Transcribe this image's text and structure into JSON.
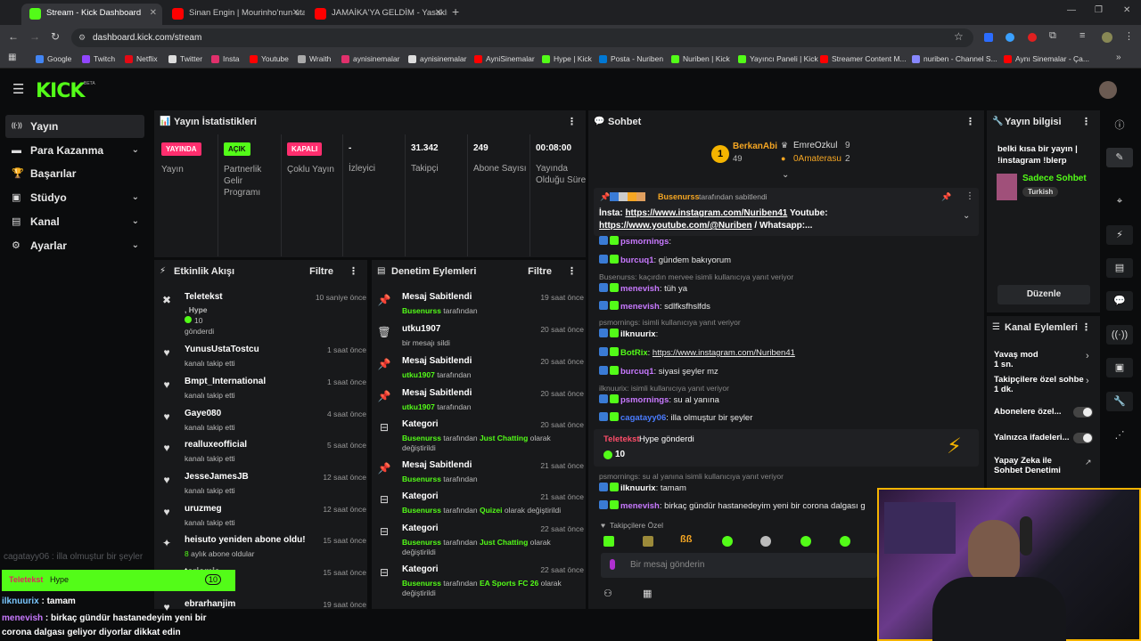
{
  "browser": {
    "tabs": [
      {
        "label": "Stream - Kick Dashboard",
        "active": true,
        "color": "#53fc18"
      },
      {
        "label": "Sinan Engin | Mourinho'nun uta",
        "active": false,
        "color": "#ff0000"
      },
      {
        "label": "JAMAİKA'YA GELDİM - Yasaklı",
        "active": false,
        "color": "#ff0000"
      }
    ],
    "url": "dashboard.kick.com/stream",
    "bookmarks": [
      {
        "label": "Google",
        "color": "#4285f4"
      },
      {
        "label": "Twitch",
        "color": "#9146ff"
      },
      {
        "label": "Netflix",
        "color": "#e50914"
      },
      {
        "label": "Twitter",
        "color": "#dddddd"
      },
      {
        "label": "Insta",
        "color": "#e1306c"
      },
      {
        "label": "Youtube",
        "color": "#ff0000"
      },
      {
        "label": "Wraith",
        "color": "#aaaaaa"
      },
      {
        "label": "aynisinemalar",
        "color": "#e1306c"
      },
      {
        "label": "aynisinemalar",
        "color": "#dddddd"
      },
      {
        "label": "AyniSinemalar",
        "color": "#ff0000"
      },
      {
        "label": "Hype | Kick",
        "color": "#53fc18"
      },
      {
        "label": "Posta - Nuriben",
        "color": "#0078d4"
      },
      {
        "label": "Nuriben | Kick",
        "color": "#53fc18"
      },
      {
        "label": "Yayıncı Paneli | Kick",
        "color": "#53fc18"
      },
      {
        "label": "Streamer Content M...",
        "color": "#ff0000"
      },
      {
        "label": "nuriben - Channel S...",
        "color": "#8888ff"
      },
      {
        "label": "Aynı Sinemalar - Ça...",
        "color": "#ff0000"
      }
    ]
  },
  "kick": {
    "logo": "KICK",
    "beta": "BETA",
    "nav": [
      {
        "label": "Yayın",
        "icon": "broadcast-icon",
        "glyph": "((·))",
        "selected": true,
        "expandable": false
      },
      {
        "label": "Para Kazanma",
        "icon": "money-icon",
        "glyph": "▬",
        "selected": false,
        "expandable": true
      },
      {
        "label": "Başarılar",
        "icon": "trophy-icon",
        "glyph": "🏆",
        "selected": false,
        "expandable": false
      },
      {
        "label": "Stüdyo",
        "icon": "studio-icon",
        "glyph": "▣",
        "selected": false,
        "expandable": true
      },
      {
        "label": "Kanal",
        "icon": "channel-icon",
        "glyph": "▤",
        "selected": false,
        "expandable": true
      },
      {
        "label": "Ayarlar",
        "icon": "gear-icon",
        "glyph": "⚙",
        "selected": false,
        "expandable": true
      }
    ]
  },
  "stats": {
    "title": "Yayın İstatistikleri",
    "items": [
      {
        "badge": "YAYINDA",
        "badge_color": "#ff2e6e",
        "label": "Yayın"
      },
      {
        "badge": "AÇIK",
        "badge_color": "#53fc18",
        "label": "Partnerlik Gelir Programı"
      },
      {
        "badge": "KAPALI",
        "badge_color": "#ff2e6e",
        "label": "Çoklu Yayın"
      },
      {
        "value": "-",
        "label": "İzleyici"
      },
      {
        "value": "31.342",
        "label": "Takipçi"
      },
      {
        "value": "249",
        "label": "Abone Sayısı"
      },
      {
        "value": "00:08:00",
        "label": "Yayında Olduğu Süre"
      }
    ]
  },
  "activity": {
    "title": "Etkinlik Akışı",
    "filter": "Filtre",
    "items": [
      {
        "name": "Teletekst",
        "line2": ", Hype",
        "line3": "10",
        "line4": "gönderdi",
        "time": "10 saniye önce",
        "icon": "kick-coin-icon"
      },
      {
        "name": "YunusUstaTostcu",
        "sub": "kanalı takip etti",
        "time": "1 saat önce",
        "icon": "heart-icon"
      },
      {
        "name": "Bmpt_International",
        "sub": "kanalı takip etti",
        "time": "1 saat önce",
        "icon": "heart-icon"
      },
      {
        "name": "Gaye080",
        "sub": "kanalı takip etti",
        "time": "4 saat önce",
        "icon": "heart-icon"
      },
      {
        "name": "realluxeofficial",
        "sub": "kanalı takip etti",
        "time": "5 saat önce",
        "icon": "heart-icon"
      },
      {
        "name": "JesseJamesJB",
        "sub": "kanalı takip etti",
        "time": "12 saat önce",
        "icon": "heart-icon"
      },
      {
        "name": "uruzmeg",
        "sub": "kanalı takip etti",
        "time": "12 saat önce",
        "icon": "heart-icon"
      },
      {
        "name": "heisuto yeniden abone oldu!",
        "sub_green": "8",
        "sub": " aylık abone oldular",
        "time": "15 saat önce",
        "icon": "sparkle-icon"
      },
      {
        "name": "toriomia",
        "sub": "",
        "time": "15 saat önce",
        "icon": "heart-icon"
      },
      {
        "name": "ebrarhanjim",
        "sub": "",
        "time": "19 saat önce",
        "icon": "heart-icon"
      }
    ]
  },
  "moderation": {
    "title": "Denetim Eylemleri",
    "filter": "Filtre",
    "items": [
      {
        "name": "Mesaj Sabitlendi",
        "green": "Busenurss",
        "rest": " tarafından",
        "time": "19 saat önce",
        "icon": "pin-icon"
      },
      {
        "name": "utku1907",
        "green": "",
        "rest": "bir mesajı sildi",
        "time": "20 saat önce",
        "icon": "trash-icon"
      },
      {
        "name": "Mesaj Sabitlendi",
        "green": "utku1907",
        "rest": " tarafından",
        "time": "20 saat önce",
        "icon": "pin-icon"
      },
      {
        "name": "Mesaj Sabitlendi",
        "green": "utku1907",
        "rest": " tarafından",
        "time": "20 saat önce",
        "icon": "pin-icon"
      },
      {
        "name": "Kategori",
        "green": "Busenurss",
        "rest": " tarafından ",
        "green2": "Just Chatting",
        "rest2": " olarak",
        "line3": "değiştirildi",
        "time": "20 saat önce",
        "icon": "category-icon"
      },
      {
        "name": "Mesaj Sabitlendi",
        "green": "Busenurss",
        "rest": " tarafından",
        "time": "21 saat önce",
        "icon": "pin-icon"
      },
      {
        "name": "Kategori",
        "green": "Busenurss",
        "rest": " tarafından ",
        "green2": "Quizei",
        "rest2": " olarak değiştirildi",
        "time": "21 saat önce",
        "icon": "category-icon"
      },
      {
        "name": "Kategori",
        "green": "Busenurss",
        "rest": " tarafından ",
        "green2": "Just Chatting",
        "rest2": " olarak",
        "line3": "değiştirildi",
        "time": "22 saat önce",
        "icon": "category-icon"
      },
      {
        "name": "Kategori",
        "green": "Busenurss",
        "rest": " tarafından ",
        "green2": "EA Sports FC 26",
        "rest2": " olarak",
        "line3": "değiştirildi",
        "time": "22 saat önce",
        "icon": "category-icon"
      }
    ]
  },
  "chat": {
    "title": "Sohbet",
    "leaderboard": {
      "first_name": "BerkanAbi",
      "first_rank": "1",
      "first_count": "49",
      "others": [
        {
          "name": "EmreOzkul",
          "count": "9"
        },
        {
          "name": "0Amaterasu",
          "count": "2"
        }
      ]
    },
    "pinned": {
      "by_name": "Busenurss",
      "by_text": " tarafından sabitlendi",
      "line1_a": "İnsta: ",
      "line1_link": "https://www.instagram.com/Nuriben41",
      "line1_b": " Youtube:",
      "line2_link": "https://www.youtube.com/@Nuriben",
      "line2_b": " / Whatsapp:..."
    },
    "messages": [
      {
        "type": "msg",
        "user": "psmornings",
        "color": "#c879ff",
        "text": ": "
      },
      {
        "type": "msg",
        "user": "burcuq1",
        "color": "#c879ff",
        "text": ": gündem bakıyorum"
      },
      {
        "type": "reply",
        "text": "Busenurss: kaçırdın mervee isimli kullanıcıya yanıt veriyor"
      },
      {
        "type": "msg",
        "user": "menevish",
        "color": "#c879ff",
        "text": ": tüh ya"
      },
      {
        "type": "msg",
        "user": "menevish",
        "color": "#c879ff",
        "text": ": sdlfksfhslfds"
      },
      {
        "type": "reply",
        "text": "psmornings:      isimli kullanıcıya yanıt veriyor"
      },
      {
        "type": "msg",
        "user": "ilknuurix",
        "color": "#ffffff",
        "text": ": "
      },
      {
        "type": "msg",
        "user": "BotRix",
        "color": "#53fc18",
        "text": ": ",
        "link": "https://www.instagram.com/Nuriben41"
      },
      {
        "type": "msg",
        "user": "burcuq1",
        "color": "#c879ff",
        "text": ": siyasi şeyler mz"
      },
      {
        "type": "reply",
        "text": "ilknuurix:      isimli kullanıcıya yanıt veriyor"
      },
      {
        "type": "msg",
        "user": "psmornings",
        "color": "#c879ff",
        "text": ": su al yanına"
      },
      {
        "type": "msg",
        "user": "cagatayy06",
        "color": "#4a7cff",
        "text": ": illa olmuştur bir şeyler"
      }
    ],
    "gift": {
      "user": "Teletekst",
      "text": " Hype gönderdi",
      "amount": "10"
    },
    "messages2": [
      {
        "type": "reply",
        "text": "psmornings: su al yanına isimli kullanıcıya yanıt veriyor"
      },
      {
        "type": "msg",
        "user": "ilknuurix",
        "color": "#ffffff",
        "text": ": tamam"
      },
      {
        "type": "msg",
        "user": "menevish",
        "color": "#c879ff",
        "text": ": birkaç gündür hastanedeyim yeni bir corona dalgası g"
      }
    ],
    "emote_bar_label": "Takipçilere Özel",
    "input_placeholder": "Bir mesaj gönderin"
  },
  "stream_info": {
    "title": "Yayın bilgisi",
    "stream_title": "belki kısa bir yayın | !instagram !blerp",
    "category": "Sadece Sohbet",
    "language": "Turkish",
    "edit_button": "Düzenle"
  },
  "channel_actions": {
    "title": "Kanal Eylemleri",
    "items": [
      {
        "label": "Yavaş mod",
        "sub": "1 sn.",
        "type": "chevron"
      },
      {
        "label": "Takipçilere özel sohbe",
        "sub": "1 dk.",
        "type": "chevron"
      },
      {
        "label": "Abonelere özel...",
        "type": "toggle"
      },
      {
        "label": "Yalnızca ifadeleri...",
        "type": "toggle"
      },
      {
        "label": "Yapay Zeka ile",
        "sub": "Sohbet Denetimi",
        "type": "link"
      }
    ]
  },
  "overlay": {
    "chat_ghost": "cagatayy06 : illa olmuştur bir şeyler",
    "alert_name": "Teletekst",
    "alert_text": "Hype",
    "alert_amount": "10",
    "line1_user": "ilknuurix",
    "line1_text": " : tamam",
    "line2_user": "menevish",
    "line2_text": " : birkaç gündür hastanedeyim yeni bir",
    "line3_text": "corona dalgası geliyor diyorlar dikkat edin"
  }
}
